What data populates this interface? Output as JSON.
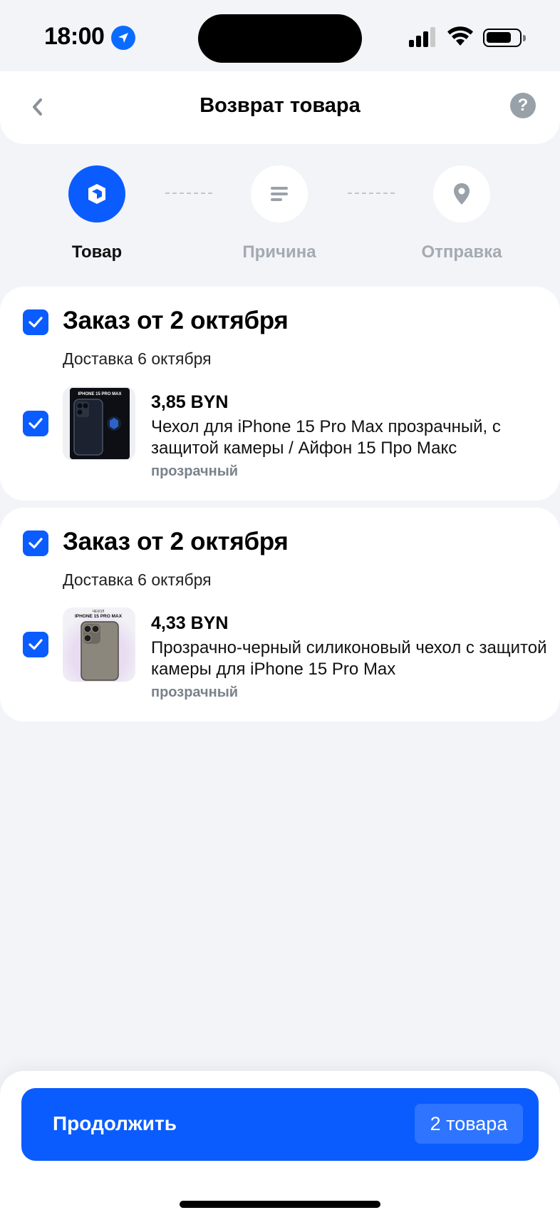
{
  "status_bar": {
    "time": "18:00"
  },
  "header": {
    "title": "Возврат товара",
    "help": "?"
  },
  "steps": [
    {
      "label": "Товар",
      "icon": "box-icon",
      "active": true
    },
    {
      "label": "Причина",
      "icon": "lines-icon",
      "active": false
    },
    {
      "label": "Отправка",
      "icon": "location-pin-icon",
      "active": false
    }
  ],
  "orders": [
    {
      "title": "Заказ от 2 октября",
      "delivery": "Доставка 6 октября",
      "checked": true,
      "item": {
        "price": "3,85 BYN",
        "name": "Чехол для iPhone 15 Pro Max прозрачный, с защитой камеры / Айфон 15 Про Макс",
        "variant": "прозрачный",
        "checked": true,
        "thumb_caption": "IPHONE 15 PRO MAX"
      }
    },
    {
      "title": "Заказ от 2 октября",
      "delivery": "Доставка 6 октября",
      "checked": true,
      "item": {
        "price": "4,33 BYN",
        "name": "Прозрачно-черный силиконовый чехол с защитой камеры для iPhone 15 Pro Max",
        "variant": "прозрачный",
        "checked": true,
        "thumb_caption_top": "ЧЕХОЛ",
        "thumb_caption": "IPHONE 15 PRO MAX"
      }
    }
  ],
  "footer": {
    "continue_label": "Продолжить",
    "count_label": "2 товара"
  },
  "colors": {
    "accent": "#0a5cff",
    "background": "#f2f4f8",
    "muted": "#a4aab2"
  }
}
